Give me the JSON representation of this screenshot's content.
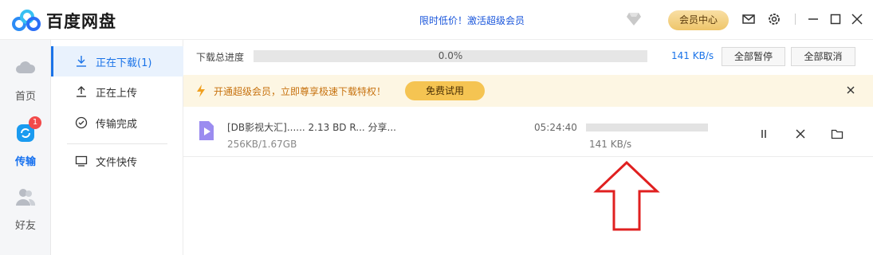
{
  "app": {
    "title": "百度网盘",
    "promo_link": "限时低价！激活超级会员",
    "vip_button": "会员中心"
  },
  "left_nav": [
    {
      "label": "首页",
      "icon": "cloud-icon"
    },
    {
      "label": "传输",
      "icon": "transfer-icon",
      "badge": "1"
    },
    {
      "label": "好友",
      "icon": "friends-icon"
    }
  ],
  "sub_nav": [
    {
      "label": "正在下载(1)",
      "icon": "download-icon"
    },
    {
      "label": "正在上传",
      "icon": "upload-icon"
    },
    {
      "label": "传输完成",
      "icon": "check-circle-icon"
    },
    {
      "label": "文件快传",
      "icon": "monitor-icon"
    }
  ],
  "progress": {
    "label": "下载总进度",
    "percent_text": "0.0%",
    "percent": 0,
    "speed": "141 KB/s",
    "pause_all": "全部暂停",
    "cancel_all": "全部取消"
  },
  "notice": {
    "text": "开通超级会员，立即尊享极速下载特权！",
    "trial_button": "免费试用"
  },
  "task": {
    "name": "[DB影视大汇]...... 2.13 BD R... 分享...",
    "size": "256KB/1.67GB",
    "time_left": "05:24:40",
    "speed": "141 KB/s",
    "progress": 0
  },
  "colors": {
    "accent": "#1a73e8",
    "notice_bg": "#fdf6e3",
    "trial": "#f5c452",
    "annotation_arrow": "#e02020"
  }
}
